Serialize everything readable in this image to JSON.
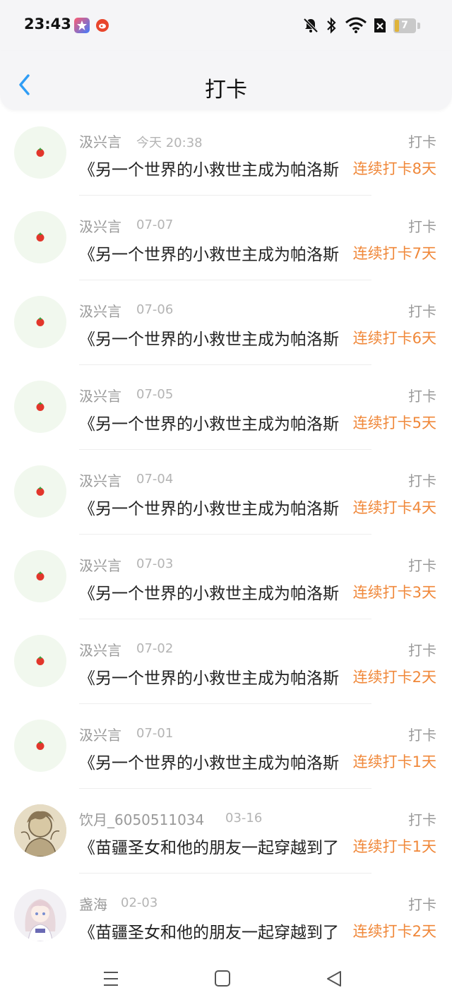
{
  "status_bar": {
    "time": "23:43",
    "battery_level": "7",
    "icons": [
      "app-store-icon",
      "weibo-icon",
      "mute-bell-icon",
      "bluetooth-icon",
      "wifi-icon",
      "sim-off-icon",
      "battery-icon"
    ]
  },
  "header": {
    "title": "打卡",
    "back_icon": "chevron-left-icon"
  },
  "colors": {
    "accent_blue": "#2f9df5",
    "streak_orange": "#f0883a",
    "avatar_bg": "#f1f8ee"
  },
  "rows": [
    {
      "user": "汲兴言",
      "time": "今天 20:38",
      "type": "打卡",
      "book": "《另一个世界的小救世主成为帕洛斯",
      "streak": "连续打卡8天",
      "avatar": "tomato-icon"
    },
    {
      "user": "汲兴言",
      "time": "07-07",
      "type": "打卡",
      "book": "《另一个世界的小救世主成为帕洛斯",
      "streak": "连续打卡7天",
      "avatar": "tomato-icon"
    },
    {
      "user": "汲兴言",
      "time": "07-06",
      "type": "打卡",
      "book": "《另一个世界的小救世主成为帕洛斯",
      "streak": "连续打卡6天",
      "avatar": "tomato-icon"
    },
    {
      "user": "汲兴言",
      "time": "07-05",
      "type": "打卡",
      "book": "《另一个世界的小救世主成为帕洛斯",
      "streak": "连续打卡5天",
      "avatar": "tomato-icon"
    },
    {
      "user": "汲兴言",
      "time": "07-04",
      "type": "打卡",
      "book": "《另一个世界的小救世主成为帕洛斯",
      "streak": "连续打卡4天",
      "avatar": "tomato-icon"
    },
    {
      "user": "汲兴言",
      "time": "07-03",
      "type": "打卡",
      "book": "《另一个世界的小救世主成为帕洛斯",
      "streak": "连续打卡3天",
      "avatar": "tomato-icon"
    },
    {
      "user": "汲兴言",
      "time": "07-02",
      "type": "打卡",
      "book": "《另一个世界的小救世主成为帕洛斯",
      "streak": "连续打卡2天",
      "avatar": "tomato-icon"
    },
    {
      "user": "汲兴言",
      "time": "07-01",
      "type": "打卡",
      "book": "《另一个世界的小救世主成为帕洛斯",
      "streak": "连续打卡1天",
      "avatar": "tomato-icon"
    },
    {
      "user": "饮月_6050511034",
      "time": "03-16",
      "type": "打卡",
      "book": "《苗疆圣女和他的朋友一起穿越到了",
      "streak": "连续打卡1天",
      "avatar": "sketch-avatar"
    },
    {
      "user": "盏海",
      "time": "02-03",
      "type": "打卡",
      "book": "《苗疆圣女和他的朋友一起穿越到了",
      "streak": "连续打卡2天",
      "avatar": "anime-avatar"
    }
  ],
  "nav_bar": {
    "icons": [
      "menu-icon",
      "home-square-icon",
      "back-triangle-icon"
    ]
  }
}
